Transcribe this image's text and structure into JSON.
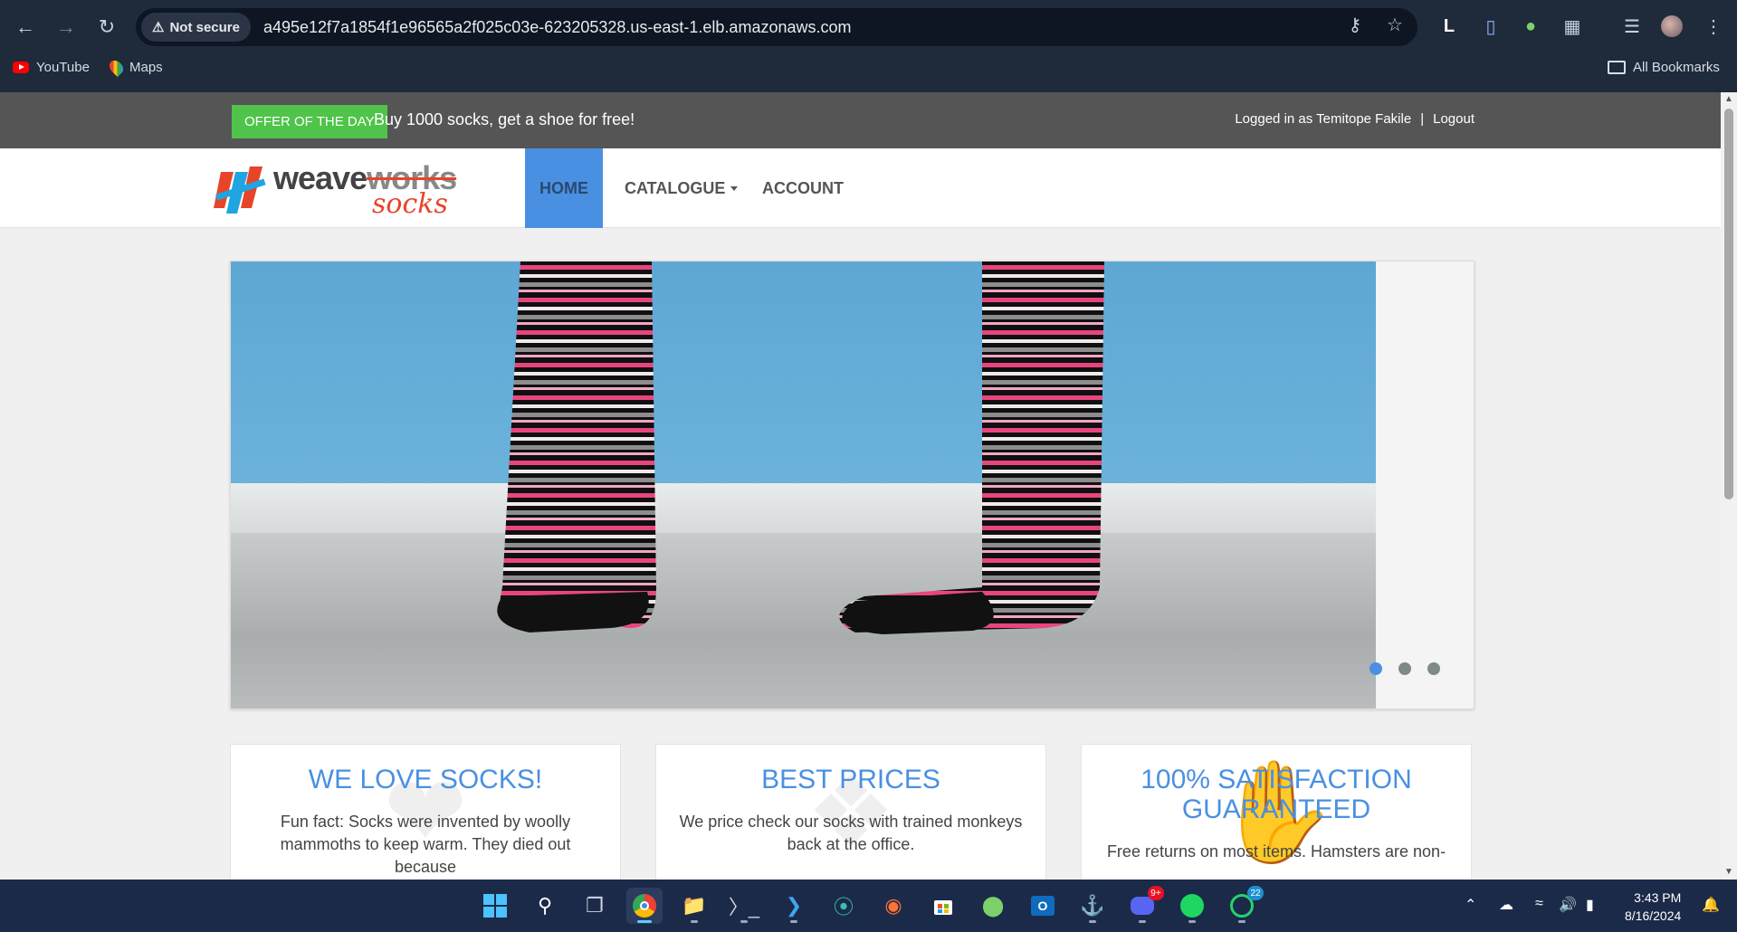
{
  "browser": {
    "security_label": "Not secure",
    "url": "a495e12f7a1854f1e96565a2f025c03e-623205328.us-east-1.elb.amazonaws.com",
    "bookmarks": [
      {
        "label": "YouTube",
        "icon": "youtube-icon"
      },
      {
        "label": "Maps",
        "icon": "maps-icon"
      }
    ],
    "all_bookmarks_label": "All Bookmarks"
  },
  "offer": {
    "badge": "OFFER OF THE DAY",
    "text": "Buy 1000 socks, get a shoe for free!"
  },
  "account": {
    "logged_in": "Logged in as Temitope Fakile",
    "separator": "|",
    "logout": "Logout"
  },
  "logo": {
    "weave": "weave",
    "works": "works",
    "socks": "socks"
  },
  "nav": {
    "home": "HOME",
    "catalogue": "CATALOGUE",
    "account": "ACCOUNT"
  },
  "carousel": {
    "active_index": 0,
    "slide_count": 3
  },
  "features": [
    {
      "title": "WE LOVE SOCKS!",
      "text": "Fun fact: Socks were invented by woolly mammoths to keep warm. They died out because"
    },
    {
      "title": "BEST PRICES",
      "text": "We price check our socks with trained monkeys back at the office."
    },
    {
      "title": "100% SATISFACTION GUARANTEED",
      "text": "Free returns on most items. Hamsters are non-"
    }
  ],
  "taskbar": {
    "discord_badge": "9+",
    "whatsapp_badge": "22",
    "time": "3:43 PM",
    "date": "8/16/2024"
  },
  "colors": {
    "accent": "#4a90e2",
    "offer_green": "#4fc34a",
    "topbar": "#555555",
    "brand_orange": "#e8442a"
  }
}
